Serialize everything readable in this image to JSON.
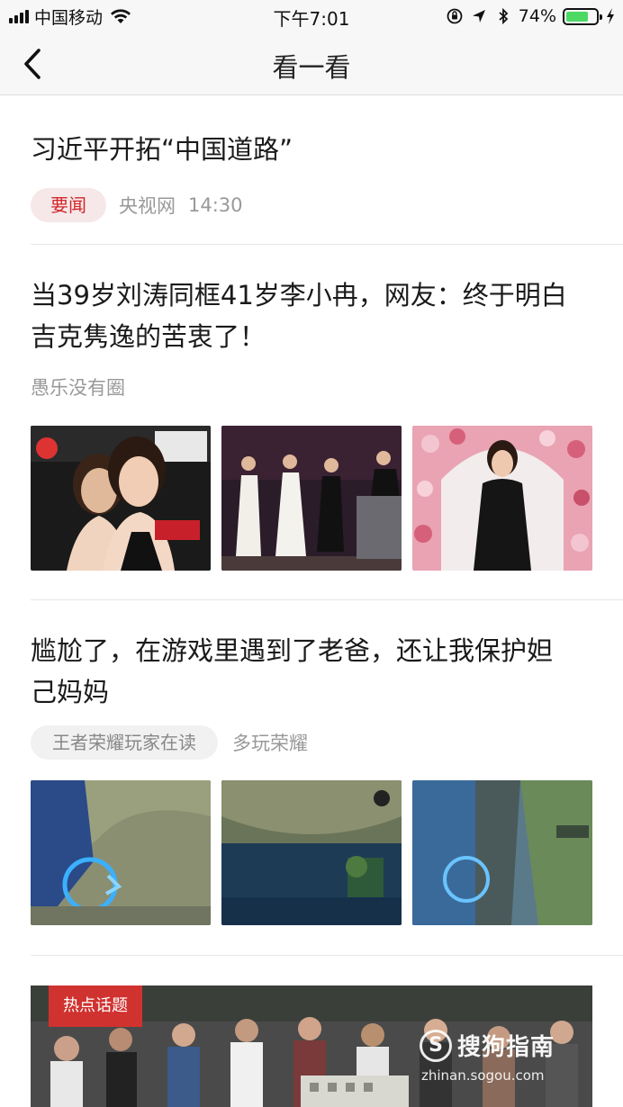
{
  "status_bar": {
    "carrier": "中国移动",
    "time": "下午7:01",
    "battery_percent": "74%",
    "battery_level": 0.74,
    "icons": [
      "signal-icon",
      "wifi-icon",
      "orientation-lock-icon",
      "location-icon",
      "bluetooth-icon",
      "battery-icon",
      "charging-icon"
    ]
  },
  "nav": {
    "title": "看一看",
    "back_icon": "chevron-left-icon"
  },
  "articles": [
    {
      "title": "习近平开拓“中国道路”",
      "tag": "要闻",
      "source": "央视网",
      "time": "14:30"
    },
    {
      "title_line1": "当39岁刘涛同框41岁李小冉，网友：终于明白",
      "title_line2": "吉克隽逸的苦衷了！",
      "source": "愚乐没有圈",
      "images": [
        "photo-two-women",
        "photo-stage-women",
        "photo-flower-backdrop"
      ]
    },
    {
      "title_line1": "尴尬了，在游戏里遇到了老爸，还让我保护妲",
      "title_line2": "己妈妈",
      "tag": "王者荣耀玩家在读",
      "source": "多玩荣耀",
      "images": [
        "game-screenshot-1",
        "game-screenshot-2",
        "game-screenshot-3"
      ]
    }
  ],
  "hot_topic": {
    "tag": "热点话题"
  },
  "watermark": {
    "logo_letter": "S",
    "brand": "搜狗指南",
    "url": "zhinan.sogou.com"
  }
}
